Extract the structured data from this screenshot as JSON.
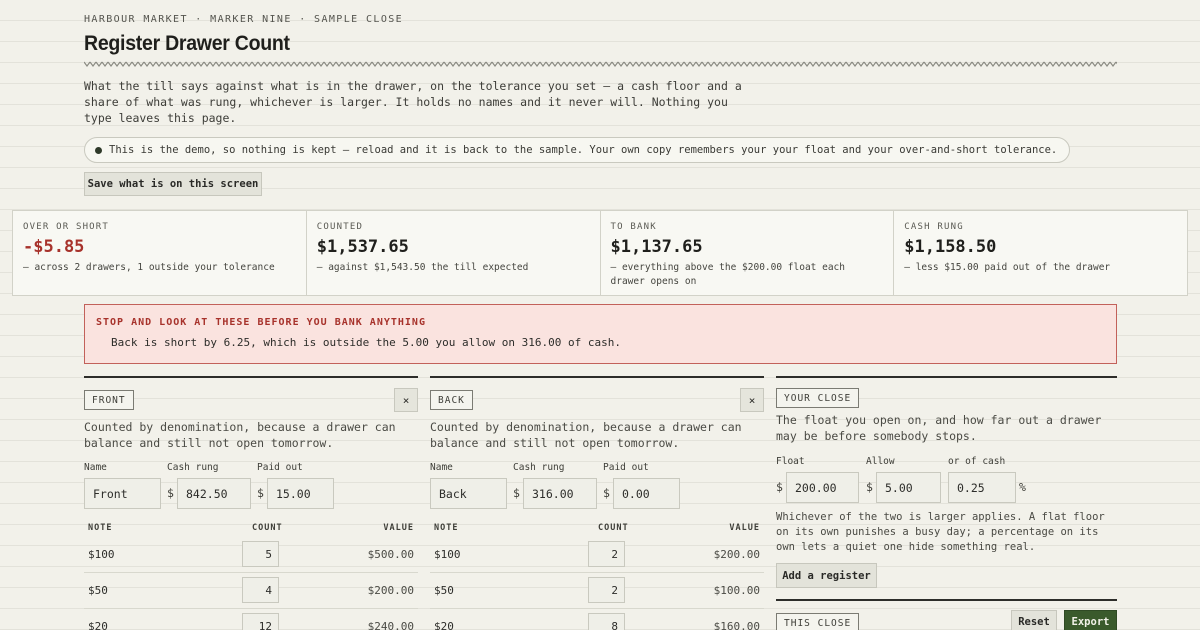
{
  "header": {
    "kicker": "HARBOUR MARKET · MARKER NINE · SAMPLE CLOSE",
    "title": "Register Drawer Count",
    "intro": "What the till says against what is in the drawer, on the tolerance you set — a cash floor and a share of what was rung, whichever is larger. It holds no names and it never will. Nothing you type leaves this page."
  },
  "notice": "This is the demo, so nothing is kept — reload and it is back to the sample. Your own copy remembers your your float and your over-and-short tolerance.",
  "save_button": "Save what is on this screen",
  "stats": [
    {
      "label": "OVER OR SHORT",
      "value": "-$5.85",
      "sub": "— across 2 drawers, 1 outside your tolerance"
    },
    {
      "label": "COUNTED",
      "value": "$1,537.65",
      "sub": "— against $1,543.50 the till expected"
    },
    {
      "label": "TO BANK",
      "value": "$1,137.65",
      "sub": "— everything above the $200.00 float each drawer opens on"
    },
    {
      "label": "CASH RUNG",
      "value": "$1,158.50",
      "sub": "— less $15.00 paid out of the drawer"
    }
  ],
  "alert": {
    "heading": "STOP AND LOOK AT THESE BEFORE YOU BANK ANYTHING",
    "body": "Back is short by 6.25, which is outside the 5.00 you allow on 316.00 of cash."
  },
  "labels": {
    "name": "Name",
    "cash_rung": "Cash rung",
    "paid_out": "Paid out",
    "col_note": "NOTE",
    "col_count": "COUNT",
    "col_value": "VALUE",
    "currency": "$",
    "close": "×"
  },
  "drawer_desc": "Counted by denomination, because a drawer can balance and still not open tomorrow.",
  "drawers": [
    {
      "tag": "FRONT",
      "name": "Front",
      "cash_rung": "842.50",
      "paid_out": "15.00",
      "rows": [
        {
          "note": "$100",
          "count": "5",
          "value": "$500.00"
        },
        {
          "note": "$50",
          "count": "4",
          "value": "$200.00"
        },
        {
          "note": "$20",
          "count": "12",
          "value": "$240.00"
        }
      ]
    },
    {
      "tag": "BACK",
      "name": "Back",
      "cash_rung": "316.00",
      "paid_out": "0.00",
      "rows": [
        {
          "note": "$100",
          "count": "2",
          "value": "$200.00"
        },
        {
          "note": "$50",
          "count": "2",
          "value": "$100.00"
        },
        {
          "note": "$20",
          "count": "8",
          "value": "$160.00"
        }
      ]
    }
  ],
  "your_close": {
    "tag": "YOUR CLOSE",
    "desc": "The float you open on, and how far out a drawer may be before somebody stops.",
    "float_label": "Float",
    "allow_label": "Allow",
    "or_cash_label": "or of cash",
    "float": "200.00",
    "allow": "5.00",
    "pct": "0.25",
    "pct_sign": "%",
    "note": "Whichever of the two is larger applies. A flat floor on its own punishes a busy day; a percentage on its own lets a quiet one hide something real.",
    "add_button": "Add a register"
  },
  "this_close": {
    "tag": "THIS CLOSE",
    "reset": "Reset",
    "export": "Export"
  }
}
